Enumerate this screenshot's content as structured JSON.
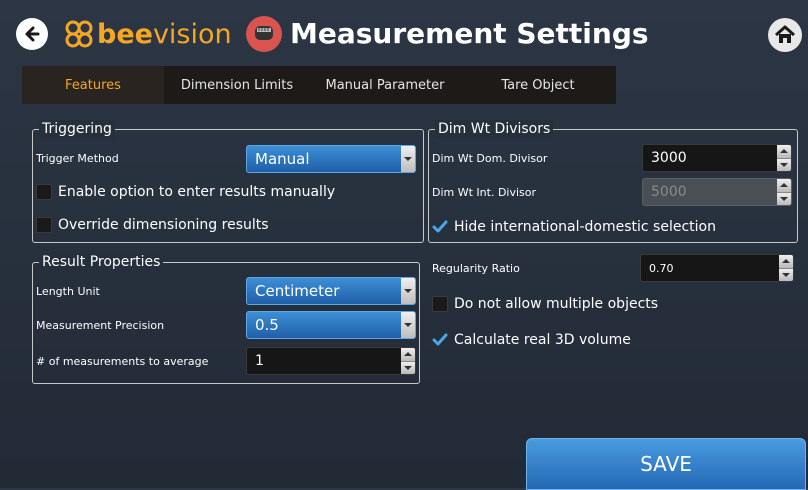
{
  "header": {
    "logo_bee": "bee",
    "logo_vision": "vision",
    "title": "Measurement Settings"
  },
  "tabs": [
    {
      "label": "Features",
      "active": true
    },
    {
      "label": "Dimension Limits",
      "active": false
    },
    {
      "label": "Manual Parameter",
      "active": false
    },
    {
      "label": "Tare Object",
      "active": false
    }
  ],
  "triggering": {
    "legend": "Triggering",
    "trigger_method_label": "Trigger Method",
    "trigger_method_value": "Manual",
    "enable_manual_label": "Enable option to enter results manually",
    "enable_manual_checked": false,
    "override_label": "Override dimensioning results",
    "override_checked": false
  },
  "result_properties": {
    "legend": "Result Properties",
    "length_unit_label": "Length Unit",
    "length_unit_value": "Centimeter",
    "precision_label": "Measurement Precision",
    "precision_value": "0.5",
    "avg_label": "# of measurements to average",
    "avg_value": "1"
  },
  "dim_wt": {
    "legend": "Dim Wt Divisors",
    "dom_label": "Dim Wt Dom. Divisor",
    "dom_value": "3000",
    "int_label": "Dim Wt Int. Divisor",
    "int_value": "5000",
    "hide_label": "Hide international-domestic selection",
    "hide_checked": true
  },
  "other": {
    "regularity_label": "Regularity Ratio",
    "regularity_value": "0.70",
    "no_multiple_label": "Do not allow multiple objects",
    "no_multiple_checked": false,
    "real3d_label": "Calculate real 3D volume",
    "real3d_checked": true
  },
  "save_label": "SAVE",
  "colors": {
    "accent_orange": "#f5a623",
    "combo_blue": "#2a74c0",
    "check_blue": "#4aa8e8"
  }
}
